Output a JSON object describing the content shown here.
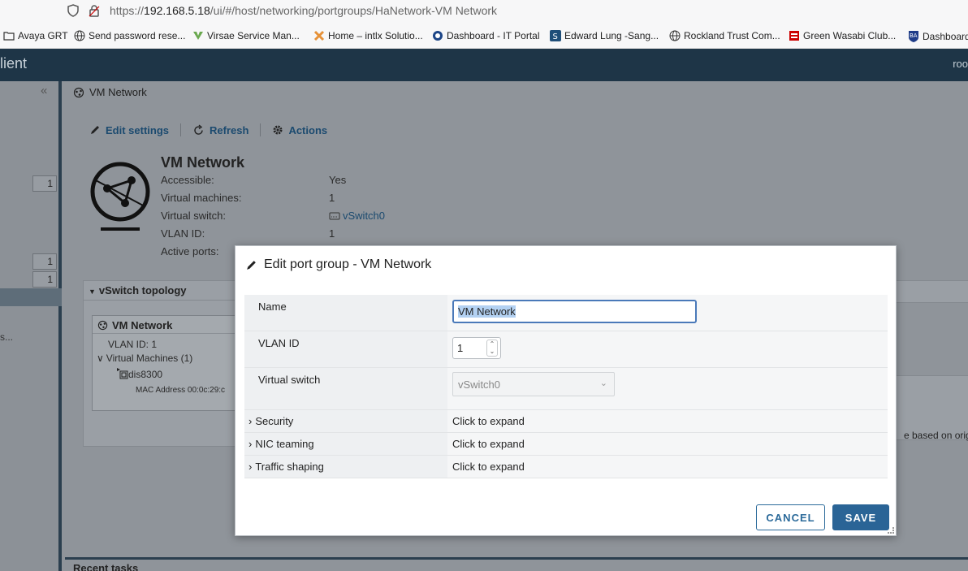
{
  "browser": {
    "url_prefix": "https://",
    "url_host": "192.168.5.18",
    "url_path": "/ui/#/host/networking/portgroups/HaNetwork-VM Network",
    "bookmarks": [
      {
        "label": "Avaya GRT",
        "color": "#ffffff"
      },
      {
        "label": "Send password rese...",
        "color": "#ffffff"
      },
      {
        "label": "Virsae Service Man...",
        "color": "#6aa84f"
      },
      {
        "label": "Home – intlx Solutio...",
        "color": "#e69138"
      },
      {
        "label": "Dashboard - IT Portal",
        "color": "#1c4587"
      },
      {
        "label": "Edward Lung -Sang...",
        "color": "#1f4e79"
      },
      {
        "label": "Rockland Trust Com...",
        "color": "#ffffff"
      },
      {
        "label": "Green Wasabi Club...",
        "color": "#cc0000"
      },
      {
        "label": "Dashboard",
        "color": "#1f3c88"
      }
    ]
  },
  "app": {
    "brand": "lient",
    "user": "roo"
  },
  "sidebar": {
    "counts": [
      "1",
      "1",
      "1"
    ],
    "truncated": "s..."
  },
  "page": {
    "breadcrumb": "VM Network",
    "toolbar": {
      "edit": "Edit settings",
      "refresh": "Refresh",
      "actions": "Actions"
    },
    "title": "VM Network",
    "props": [
      {
        "key": "Accessible:",
        "value": "Yes"
      },
      {
        "key": "Virtual machines:",
        "value": "1"
      },
      {
        "key": "Virtual switch:",
        "value": "vSwitch0"
      },
      {
        "key": "VLAN ID:",
        "value": "1"
      },
      {
        "key": "Active ports:",
        "value": ""
      }
    ]
  },
  "topology": {
    "header": "vSwitch topology",
    "card_title": "VM Network",
    "vlan": "VLAN ID: 1",
    "vms": "Virtual Machines (1)",
    "vm": "dis8300",
    "mac": "MAC Address 00:0c:29:c"
  },
  "right_panel": {
    "text": "e based on orig"
  },
  "recent": {
    "label": "Recent tasks"
  },
  "modal": {
    "title": "Edit port group - VM Network",
    "name_label": "Name",
    "name_value": "VM Network",
    "vlan_label": "VLAN ID",
    "vlan_value": "1",
    "vswitch_label": "Virtual switch",
    "vswitch_value": "vSwitch0",
    "sections": [
      {
        "label": "Security",
        "value": "Click to expand"
      },
      {
        "label": "NIC teaming",
        "value": "Click to expand"
      },
      {
        "label": "Traffic shaping",
        "value": "Click to expand"
      }
    ],
    "cancel": "CANCEL",
    "save": "SAVE"
  }
}
